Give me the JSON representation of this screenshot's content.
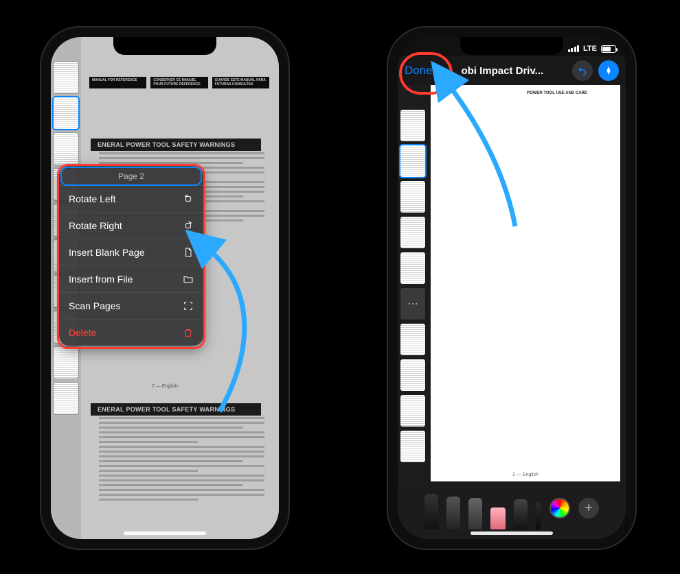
{
  "left": {
    "warning_band_text": "ENERAL POWER TOOL SAFETY WARNINGS",
    "box_row": [
      "MANUAL FOR\nREFERENCE",
      "CONSERVER CE MANUEL\nPOUR FUTURE RÉFÉRENCE",
      "GUARDE ESTE MANUAL\nPARA FUTURAS CONSULTAS"
    ],
    "page_footer": "2 — English",
    "thumb_count": 10,
    "popover": {
      "header": "Page 2",
      "items": [
        {
          "label": "Rotate Left",
          "icon": "rotate-left",
          "destructive": false
        },
        {
          "label": "Rotate Right",
          "icon": "rotate-right",
          "destructive": false
        },
        {
          "label": "Insert Blank Page",
          "icon": "blank-page",
          "destructive": false
        },
        {
          "label": "Insert from File",
          "icon": "folder",
          "destructive": false
        },
        {
          "label": "Scan Pages",
          "icon": "scan",
          "destructive": false
        },
        {
          "label": "Delete",
          "icon": "trash",
          "destructive": true
        }
      ]
    }
  },
  "right": {
    "status": {
      "network_label": "LTE"
    },
    "navbar": {
      "done_label": "Done",
      "title": "obi Impact Driv...",
      "undo_icon": "undo",
      "markup_icon": "pen-tip"
    },
    "thumb_count": 10,
    "warning_band_text": "POWER TOOL USE AND CARE",
    "page_footer": "2 — English",
    "markup_tools": [
      "pen",
      "marker",
      "pencil",
      "eraser",
      "lasso",
      "ruler"
    ],
    "add_label": "+"
  },
  "annotations": {
    "arrow_color": "#2aa9ff"
  }
}
